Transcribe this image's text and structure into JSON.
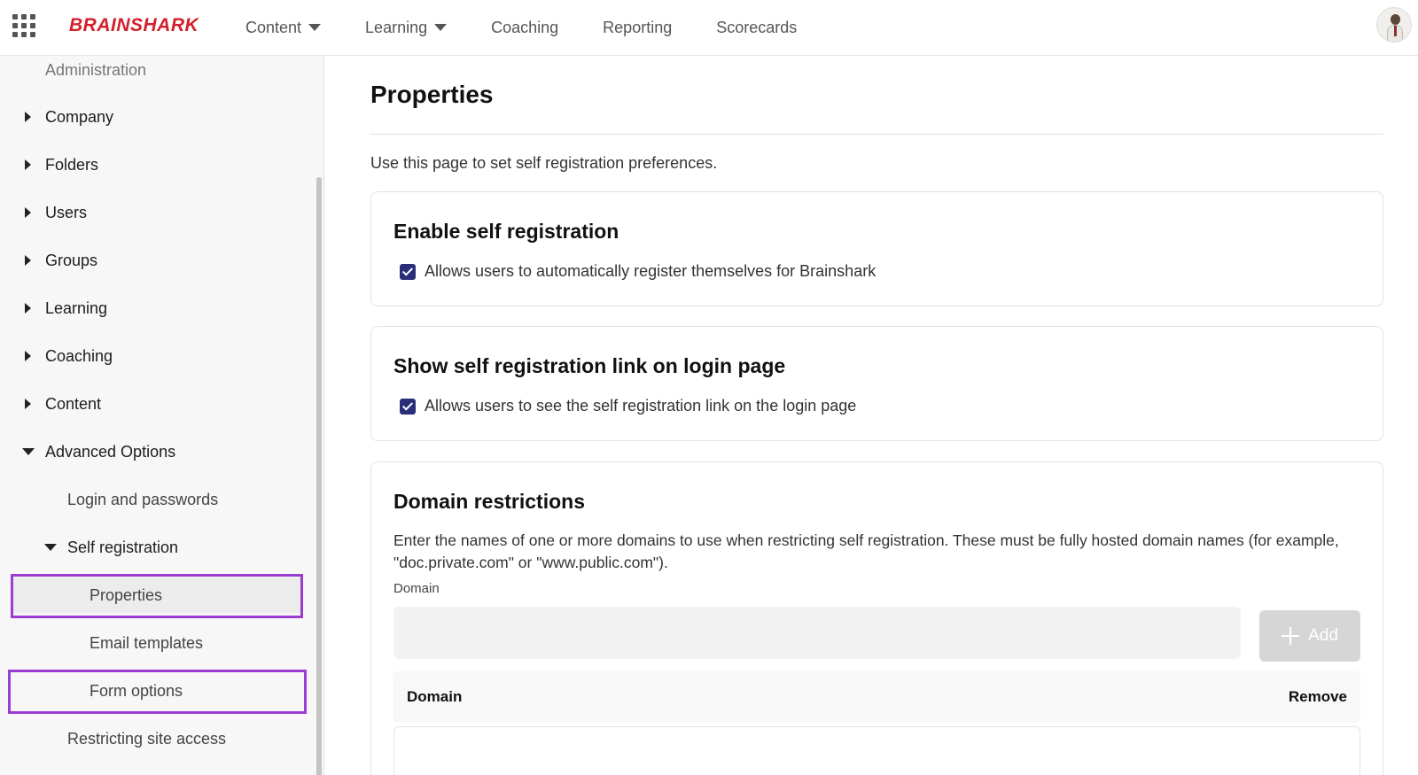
{
  "topbar": {
    "logo": "BRAINSHARK",
    "nav": [
      {
        "label": "Content",
        "has_dropdown": true
      },
      {
        "label": "Learning",
        "has_dropdown": true
      },
      {
        "label": "Coaching",
        "has_dropdown": false
      },
      {
        "label": "Reporting",
        "has_dropdown": false
      },
      {
        "label": "Scorecards",
        "has_dropdown": false
      }
    ]
  },
  "sidebar": {
    "section": "Administration",
    "items": [
      {
        "label": "Company",
        "expanded": false
      },
      {
        "label": "Folders",
        "expanded": false
      },
      {
        "label": "Users",
        "expanded": false
      },
      {
        "label": "Groups",
        "expanded": false
      },
      {
        "label": "Learning",
        "expanded": false
      },
      {
        "label": "Coaching",
        "expanded": false
      },
      {
        "label": "Content",
        "expanded": false
      },
      {
        "label": "Advanced Options",
        "expanded": true
      }
    ],
    "advanced": {
      "login_passwords": "Login and passwords",
      "self_registration": "Self registration",
      "properties": "Properties",
      "email_templates": "Email templates",
      "form_options": "Form options",
      "restricting_site_access": "Restricting site access"
    }
  },
  "main": {
    "title": "Properties",
    "description": "Use this page to set self registration preferences.",
    "enable_card": {
      "title": "Enable self registration",
      "checkbox_label": "Allows users to automatically register themselves for Brainshark",
      "checked": true
    },
    "show_link_card": {
      "title": "Show self registration link on login page",
      "checkbox_label": "Allows users to see the self registration link on the login page",
      "checked": true
    },
    "domain_card": {
      "title": "Domain restrictions",
      "description": "Enter the names of one or more domains to use when restricting self registration. These must be fully hosted domain names (for example, \"doc.private.com\" or \"www.public.com\").",
      "field_label": "Domain",
      "input_value": "",
      "add_label": "Add",
      "col_domain": "Domain",
      "col_remove": "Remove"
    }
  },
  "colors": {
    "brand": "#d4202c",
    "checkbox": "#2b2f7a",
    "highlight": "#9b3dd3"
  }
}
